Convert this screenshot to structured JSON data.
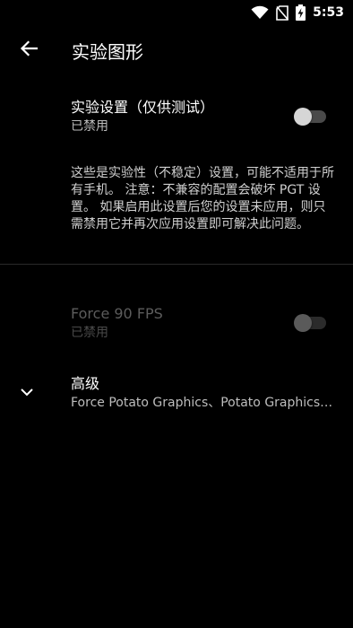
{
  "status_bar": {
    "time": "5:53",
    "icons": [
      "wifi-icon",
      "no-sim-icon",
      "battery-charging-icon"
    ]
  },
  "app_bar": {
    "title": "实验图形",
    "back_icon": "arrow-back-icon"
  },
  "experimental_setting": {
    "title": "实验设置（仅供测试）",
    "status": "已禁用",
    "enabled": false
  },
  "description": "这些是实验性（不稳定）设置，可能不适用于所有手机。 注意：不兼容的配置会破坏 PGT 设置。 如果启用此设置后您的设置未应用，则只需禁用它并再次应用设置即可解决此问题。",
  "force_90_fps": {
    "title": "Force 90 FPS",
    "status": "已禁用",
    "enabled": false,
    "disabled": true
  },
  "advanced": {
    "title": "高级",
    "summary": "Force Potato Graphics、Potato Graphics L...",
    "icon": "chevron-down-icon"
  },
  "colors": {
    "background": "#000000",
    "text_primary": "#ffffff",
    "text_secondary": "#bdbdbd"
  }
}
